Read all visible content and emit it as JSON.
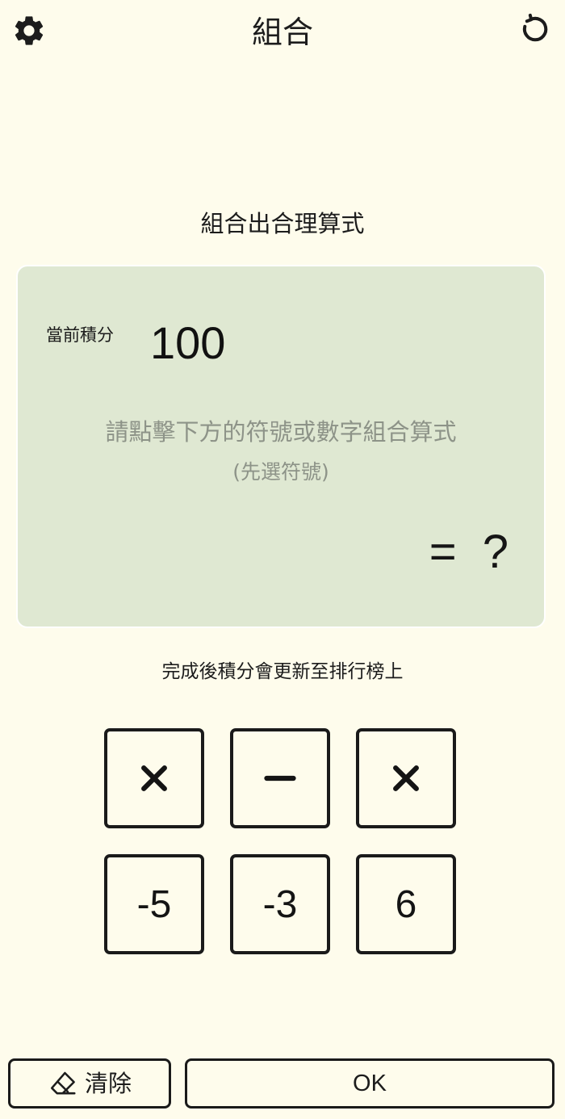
{
  "header": {
    "title": "組合",
    "settings_icon": "gear-icon",
    "reset_icon": "refresh-icon"
  },
  "instruction": "組合出合理算式",
  "card": {
    "score_label": "當前積分",
    "score_value": "100",
    "hint": "請點擊下方的符號或數字組合算式",
    "hint_sub": "(先選符號)",
    "result": "= ?"
  },
  "leaderboard_note": "完成後積分會更新至排行榜上",
  "operators": [
    "×",
    "−",
    "×"
  ],
  "numbers": [
    "-5",
    "-3",
    "6"
  ],
  "buttons": {
    "clear_label": "清除",
    "clear_icon": "eraser-icon",
    "ok_label": "OK"
  },
  "colors": {
    "background": "#fefcec",
    "card_background": "#dfe8d2",
    "hint_text": "#8d9388",
    "border": "#1a1a1a"
  }
}
